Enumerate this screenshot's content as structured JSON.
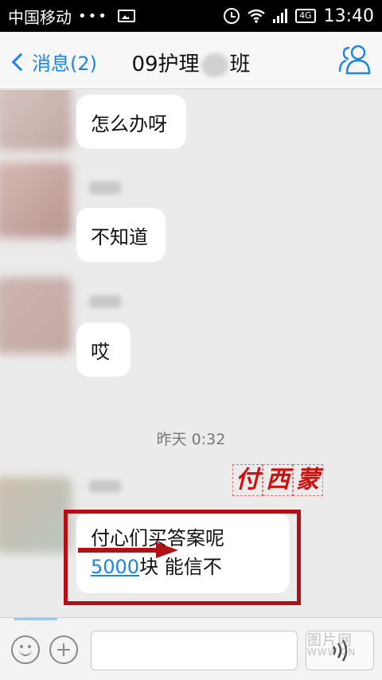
{
  "status_bar": {
    "carrier": "中国移动",
    "dots": "•••",
    "network": "4G",
    "time": "13:40"
  },
  "nav": {
    "back_label": "消息(2)",
    "title_part1": "09护理",
    "title_part2": "班"
  },
  "messages": [
    {
      "text": "怎么办呀"
    },
    {
      "text": "不知道"
    },
    {
      "text": "哎"
    }
  ],
  "timestamp": "昨天 0:32",
  "last_message": {
    "line1": "付心们买答案呢",
    "link": "5000",
    "line2_rest": "块  能信不"
  },
  "stamp": [
    "付",
    "西",
    "蒙"
  ],
  "input": {
    "placeholder": ""
  },
  "watermark": {
    "main": "图片网",
    "sub": "WWW.CN"
  },
  "colors": {
    "accent": "#1a86e6",
    "annotation": "#b01016"
  }
}
